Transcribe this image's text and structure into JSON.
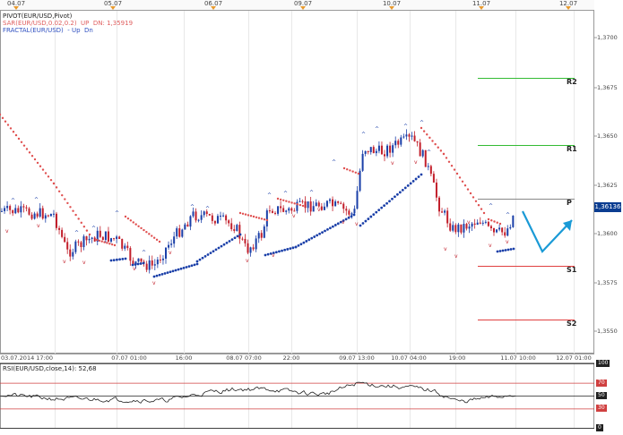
{
  "top_axis": {
    "dates": [
      "04.07",
      "05.07",
      "06.07",
      "09.07",
      "10.07",
      "11.07",
      "12.07"
    ]
  },
  "legend": {
    "pivot": "PIVOT(EUR/USD,Pivot)",
    "sar": "SAR(EUR/USD,0.02,0.2)",
    "sar_status": "UP",
    "sar_dn": "DN: 1,35919",
    "fractal": "FRACTAL(EUR/USD)",
    "fractal_up": "- Up",
    "fractal_dn": "Dn"
  },
  "price_axis": {
    "ticks": [
      "1,3700",
      "1,3675",
      "1,3650",
      "1,3625",
      "1,3600",
      "1,3575",
      "1,3550"
    ],
    "current": "1,36136"
  },
  "pivot_levels": [
    {
      "label": "R2",
      "color": "#33bb33"
    },
    {
      "label": "R1",
      "color": "#33bb33"
    },
    {
      "label": "P",
      "color": "#888888"
    },
    {
      "label": "S1",
      "color": "#e04040"
    },
    {
      "label": "S2",
      "color": "#e04040"
    }
  ],
  "time_axis": {
    "labels": [
      "03.07.2014 17:00",
      "07.07 01:00",
      "16:00",
      "08.07 07:00",
      "22:00",
      "09.07 13:00",
      "10.07 04:00",
      "19:00",
      "11.07 10:00",
      "12.07 01:00"
    ]
  },
  "rsi": {
    "legend": "RSI(EUR/USD,close,14): 52,68",
    "tags": [
      "100",
      "70",
      "50",
      "30",
      "0"
    ],
    "tag_colors": [
      "#222222",
      "#d04040",
      "#222222",
      "#d04040",
      "#222222"
    ]
  },
  "colors": {
    "bull": "#1a3fa8",
    "bear": "#c21f2b",
    "sar": "#e05050",
    "sar_support": "#1a3fa8",
    "projection": "#1a9ad6"
  }
}
